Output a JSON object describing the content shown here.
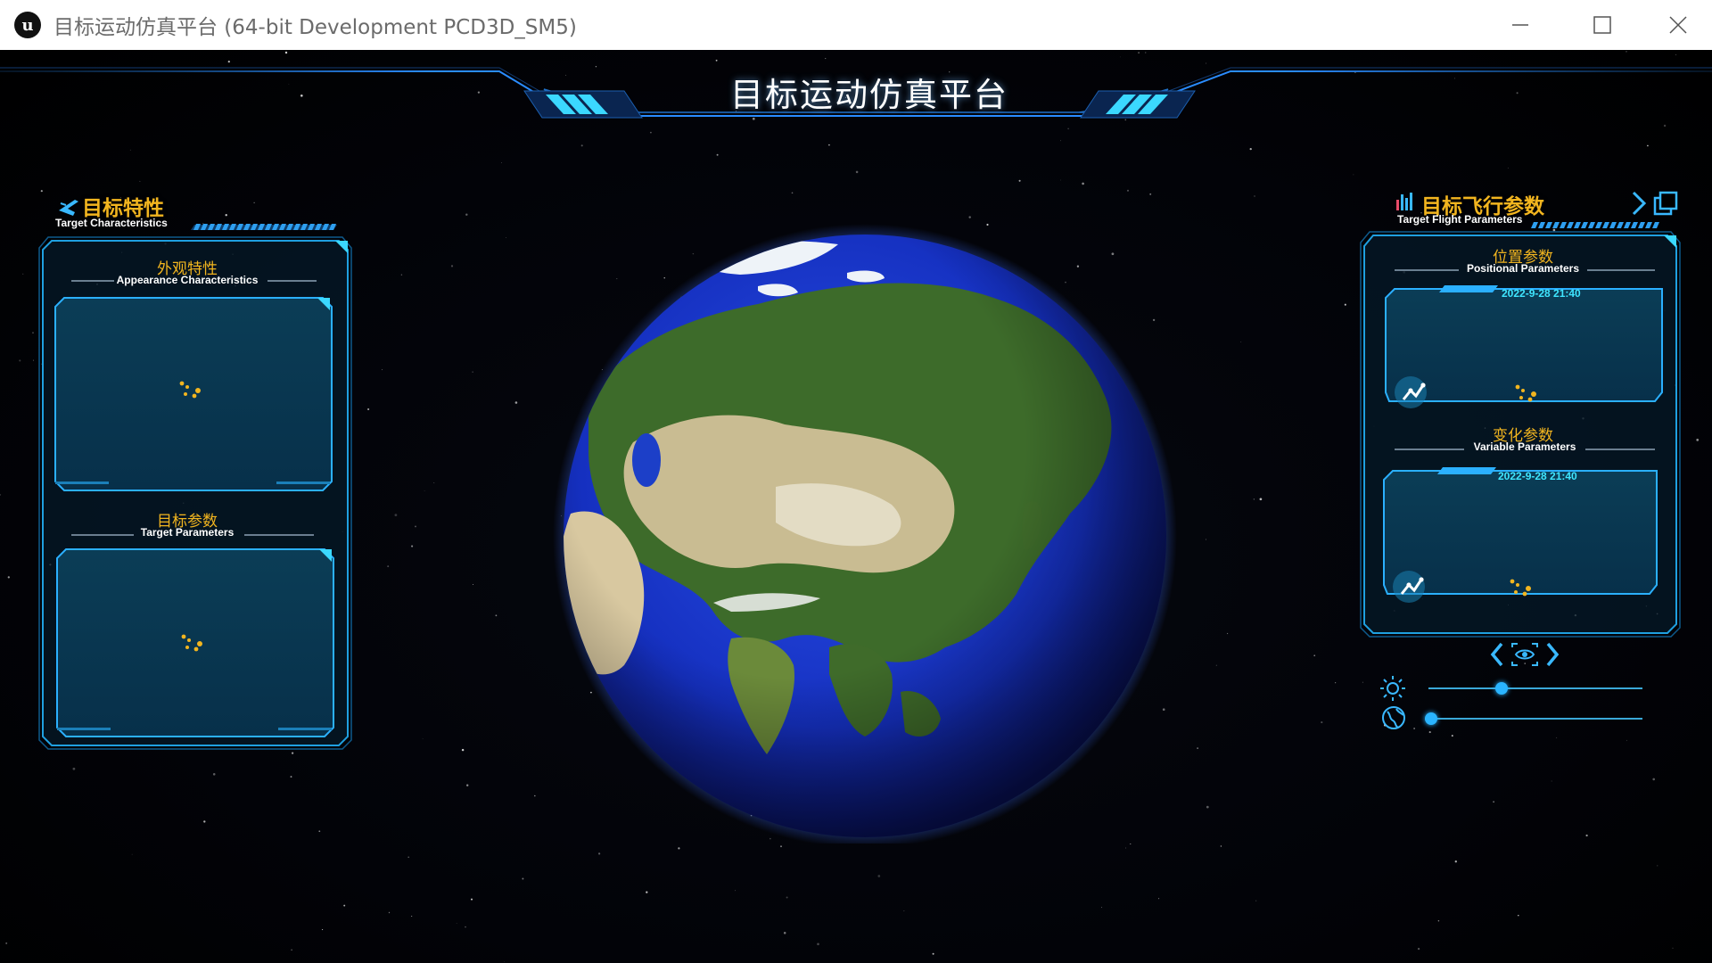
{
  "window": {
    "title": "目标运动仿真平台 (64-bit Development PCD3D_SM5)",
    "logo_icon": "unreal-engine-logo",
    "controls": [
      "minimize-icon",
      "maximize-icon",
      "close-icon"
    ]
  },
  "header": {
    "title": "目标运动仿真平台"
  },
  "left_panel": {
    "title_cn": "目标特性",
    "title_en": "Target Characteristics",
    "icon": "aircraft-icon",
    "sections": [
      {
        "title_cn": "外观特性",
        "title_en": "Appearance Characteristics",
        "status": "loading"
      },
      {
        "title_cn": "目标参数",
        "title_en": "Target Parameters",
        "status": "loading"
      }
    ]
  },
  "right_panel": {
    "title_cn": "目标飞行参数",
    "title_en": "Target Flight Parameters",
    "icon": "signal-bars-icon",
    "header_buttons": [
      "collapse-chevron-icon",
      "popout-window-icon"
    ],
    "sections": [
      {
        "title_cn": "位置参数",
        "title_en": "Positional Parameters",
        "timestamp": "2022-9-28 21:40",
        "status": "loading"
      },
      {
        "title_cn": "变化参数",
        "title_en": "Variable Parameters",
        "timestamp": "2022-9-28 21:40",
        "status": "loading"
      }
    ]
  },
  "view_controls": {
    "prev_icon": "chevron-left-icon",
    "view_icon": "eye-focus-icon",
    "next_icon": "chevron-right-icon",
    "brightness": {
      "icon": "sun-icon",
      "value": 0.33
    },
    "globe_rotation": {
      "icon": "globe-icon",
      "value": 0.0
    }
  },
  "colors": {
    "accent_gold": "#f2b51f",
    "accent_cyan": "#3fe6ff",
    "panel_border": "#1fa0e0",
    "panel_fill": "#0b3a50"
  }
}
